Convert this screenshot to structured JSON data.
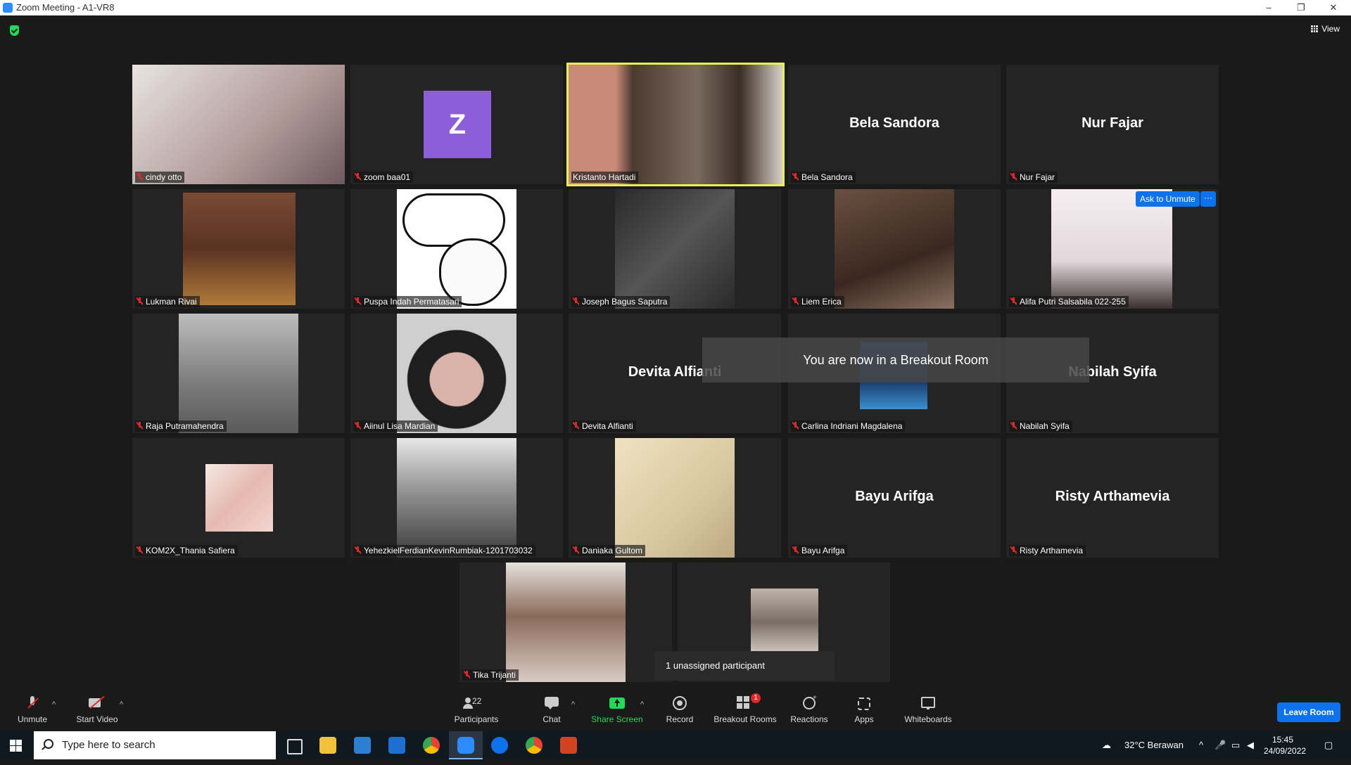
{
  "window": {
    "title": "Zoom Meeting - A1-VR8",
    "min": "–",
    "max": "❐",
    "close": "✕"
  },
  "top": {
    "view_label": "View"
  },
  "tiles": [
    {
      "name": "cindy otto",
      "type": "video",
      "color": "#c9b7b5"
    },
    {
      "name": "zoom baa01",
      "type": "avatar",
      "initial": "Z"
    },
    {
      "name": "Kristanto Hartadi",
      "type": "video",
      "color": "#7a5a45",
      "active": true
    },
    {
      "name": "Bela Sandora",
      "type": "name",
      "display": "Bela Sandora"
    },
    {
      "name": "Nur Fajar",
      "type": "name",
      "display": "Nur Fajar"
    },
    {
      "name": "Lukman Rivai",
      "type": "video",
      "color": "#6b3d2a"
    },
    {
      "name": "Puspa Indah Permatasari",
      "type": "video",
      "color": "#f2f2f2"
    },
    {
      "name": "Joseph Bagus Saputra",
      "type": "video",
      "color": "#3a3a3a"
    },
    {
      "name": "Liem Erica",
      "type": "video",
      "color": "#5a4337"
    },
    {
      "name": "Alifa Putri Salsabila 022-255",
      "type": "video",
      "color": "#ebe6e8"
    },
    {
      "name": "Raja Putramahendra",
      "type": "video",
      "color": "#8a8a8a"
    },
    {
      "name": "Aiinul Lisa Mardian",
      "type": "video",
      "color": "#b9a7a2"
    },
    {
      "name": "Devita Alfianti",
      "type": "name",
      "display": "Devita Alfianti"
    },
    {
      "name": "Carlina Indriani Magdalena",
      "type": "video",
      "color": "#3b6fa8"
    },
    {
      "name": "Nabilah Syifa",
      "type": "name",
      "display": "Nabilah Syifa"
    },
    {
      "name": "KOM2X_Thania Safiera",
      "type": "video",
      "color": "#e8c9c0"
    },
    {
      "name": "YehezkielFerdianKevinRumbiak-1201703032",
      "type": "video",
      "color": "#7d7d7d"
    },
    {
      "name": "Daniaka Gultom",
      "type": "video",
      "color": "#d9caa5"
    },
    {
      "name": "Bayu Arifga",
      "type": "name",
      "display": "Bayu Arifga"
    },
    {
      "name": "Risty Arthamevia",
      "type": "name",
      "display": "Risty Arthamevia"
    },
    {
      "name": "Tika Trijanti",
      "type": "video",
      "color": "#b8a095"
    },
    {
      "name": "",
      "type": "video",
      "color": "#9a8f86"
    }
  ],
  "overlays": {
    "ask_to_unmute": "Ask to Unmute",
    "more": "···",
    "toast": "You are now in a Breakout Room",
    "unassigned": "1 unassigned participant"
  },
  "toolbar": {
    "unmute": "Unmute",
    "start_video": "Start Video",
    "participants": "Participants",
    "participants_count": "22",
    "chat": "Chat",
    "share_screen": "Share Screen",
    "record": "Record",
    "breakout_rooms": "Breakout Rooms",
    "breakout_badge": "1",
    "reactions": "Reactions",
    "apps": "Apps",
    "whiteboards": "Whiteboards",
    "leave": "Leave Room",
    "share_color": "#23d959"
  },
  "taskbar": {
    "search_placeholder": "Type here to search",
    "weather": "32°C Berawan",
    "time": "15:45",
    "date": "24/09/2022"
  }
}
